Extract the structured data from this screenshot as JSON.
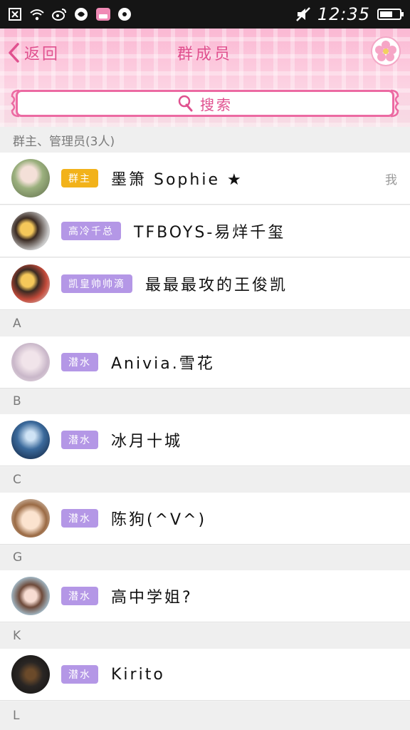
{
  "status_bar": {
    "time": "12:35"
  },
  "header": {
    "back_label": "返回",
    "title": "群成员",
    "search_label": "搜索"
  },
  "admin_section": {
    "label": "群主、管理员(3人)"
  },
  "admins": [
    {
      "badge": "群主",
      "name": "墨箫 Sophie ★",
      "note": "我"
    },
    {
      "badge": "高冷千总",
      "name": "TFBOYS-易烊千玺"
    },
    {
      "badge": "凯皇帅帅滴",
      "name": "最最最攻的王俊凯"
    }
  ],
  "groups": [
    {
      "letter": "A",
      "member": {
        "badge": "潜水",
        "name": "Anivia.雪花"
      }
    },
    {
      "letter": "B",
      "member": {
        "badge": "潜水",
        "name": "冰月十城"
      }
    },
    {
      "letter": "C",
      "member": {
        "badge": "潜水",
        "name": "陈狗(^V^)"
      }
    },
    {
      "letter": "G",
      "member": {
        "badge": "潜水",
        "name": "高中学姐?"
      }
    },
    {
      "letter": "K",
      "member": {
        "badge": "潜水",
        "name": "Kirito"
      }
    },
    {
      "letter": "L"
    }
  ],
  "colors": {
    "accent": "#e0518f",
    "owner_badge": "#f2b21a",
    "member_badge": "#b497e6"
  }
}
